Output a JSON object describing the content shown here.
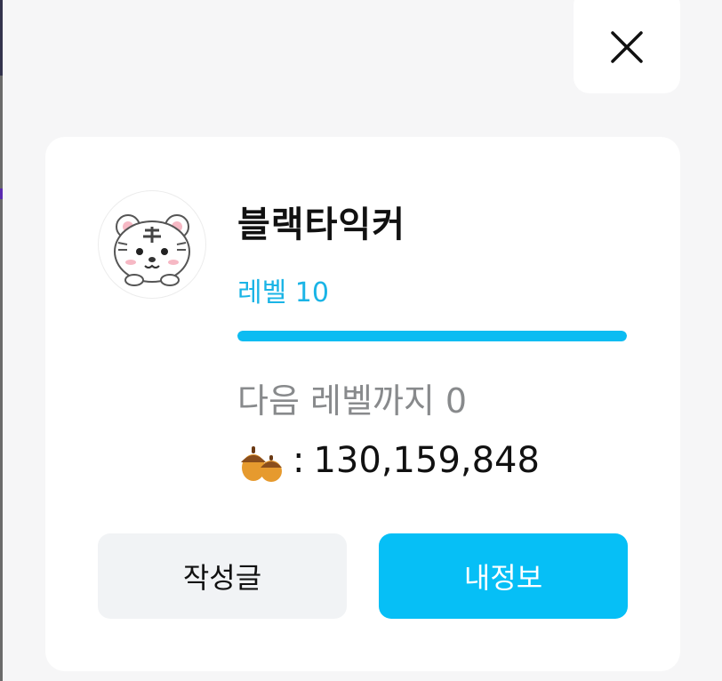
{
  "close_button": {
    "icon": "close-icon"
  },
  "profile": {
    "avatar_icon": "tiger-avatar-icon",
    "nickname": "블랙타익커",
    "level_label": "레벨 10",
    "level_progress": 1.0,
    "next_level_text": "다음 레벨까지 0",
    "points_icon": "acorn-icon",
    "points_separator": ":",
    "points_value": "130,159,848"
  },
  "buttons": {
    "posts_label": "작성글",
    "myinfo_label": "내정보"
  },
  "colors": {
    "accent": "#06bff6",
    "level_text": "#1ab4e6",
    "muted_text": "#888a8c"
  }
}
